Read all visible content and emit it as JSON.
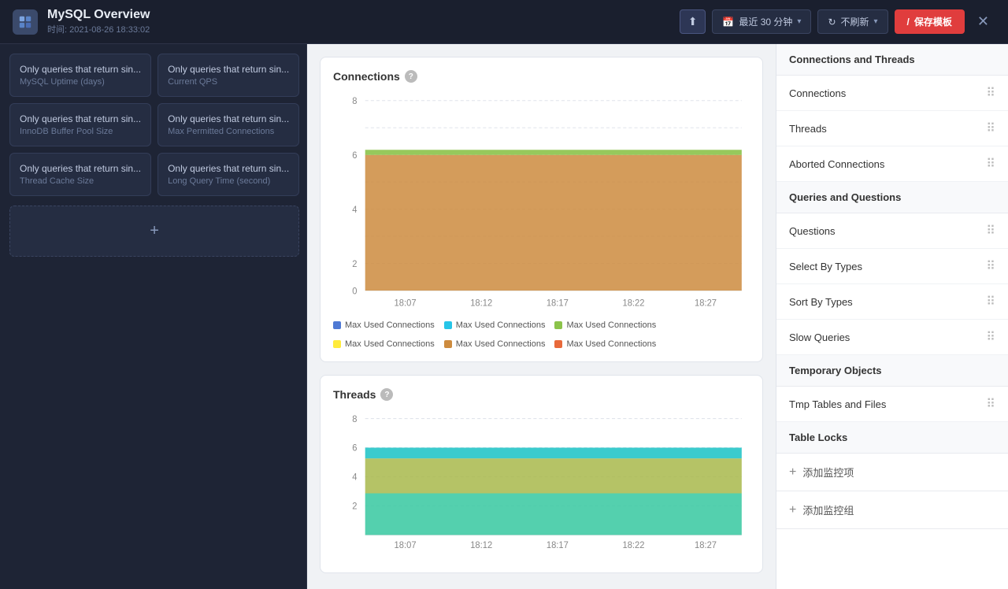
{
  "header": {
    "logo_alt": "dashboard-logo",
    "title": "MySQL Overview",
    "subtitle": "时间: 2021-08-26 18:33:02",
    "time_range_label": "最近 30 分钟",
    "refresh_label": "不刷新",
    "save_label": "保存模板",
    "time_icon": "🕐",
    "refresh_icon": "↻",
    "slash_icon": "/"
  },
  "left_sidebar": {
    "cards": [
      {
        "title": "Only queries that return sin...",
        "subtitle": "MySQL Uptime (days)"
      },
      {
        "title": "Only queries that return sin...",
        "subtitle": "Current QPS"
      },
      {
        "title": "Only queries that return sin...",
        "subtitle": "InnoDB Buffer Pool Size"
      },
      {
        "title": "Only queries that return sin...",
        "subtitle": "Max Permitted Connections"
      },
      {
        "title": "Only queries that return sin...",
        "subtitle": "Thread Cache Size"
      },
      {
        "title": "Only queries that return sin...",
        "subtitle": "Long Query Time (second)"
      }
    ],
    "add_label": "+"
  },
  "connections_chart": {
    "title": "Connections",
    "info": "?",
    "y_labels": [
      "8",
      "6",
      "4",
      "2",
      "0"
    ],
    "x_labels": [
      "18:07",
      "18:12",
      "18:17",
      "18:22",
      "18:27"
    ],
    "legend": [
      {
        "color": "#4e79d4",
        "label": "Max Used Connections"
      },
      {
        "color": "#26c5e8",
        "label": "Max Used Connections"
      },
      {
        "color": "#8bc34a",
        "label": "Max Used Connections"
      },
      {
        "color": "#ffeb3b",
        "label": "Max Used Connections"
      },
      {
        "color": "#cd8b3e",
        "label": "Max Used Connections"
      },
      {
        "color": "#e8693a",
        "label": "Max Used Connections"
      }
    ]
  },
  "threads_chart": {
    "title": "Threads",
    "info": "?",
    "y_labels": [
      "8",
      "6",
      "4",
      "2"
    ],
    "x_labels": [
      "18:07",
      "18:12",
      "18:17",
      "18:22",
      "18:27"
    ]
  },
  "right_sidebar": {
    "sections": [
      {
        "header": "Connections and Threads",
        "items": [
          {
            "label": "Connections",
            "draggable": true
          },
          {
            "label": "Threads",
            "draggable": true
          },
          {
            "label": "Aborted Connections",
            "draggable": true
          }
        ]
      },
      {
        "header": "Queries and Questions",
        "items": [
          {
            "label": "Questions",
            "draggable": true
          },
          {
            "label": "Select By Types",
            "draggable": true
          },
          {
            "label": "Sort By Types",
            "draggable": true
          },
          {
            "label": "Slow Queries",
            "draggable": true
          }
        ]
      },
      {
        "header": "Temporary Objects",
        "items": [
          {
            "label": "Tmp Tables and Files",
            "draggable": true
          }
        ]
      },
      {
        "header": "Table Locks",
        "items": []
      }
    ],
    "add_monitor_label": "添加监控项",
    "add_group_label": "添加监控组"
  }
}
